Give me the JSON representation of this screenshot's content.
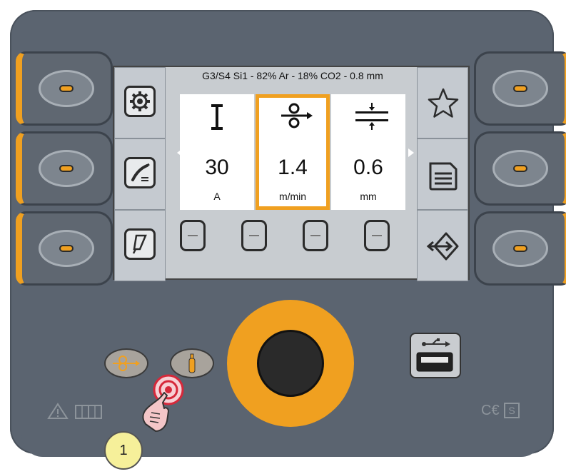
{
  "screen": {
    "title": "G3/S4 Si1 - 82% Ar - 18% CO2 - 0.8 mm",
    "params": [
      {
        "value": "30",
        "unit": "A",
        "icon": "current-icon"
      },
      {
        "value": "1.4",
        "unit": "m/min",
        "icon": "wire-feed-icon",
        "selected": true
      },
      {
        "value": "0.6",
        "unit": "mm",
        "icon": "thickness-icon"
      }
    ],
    "mini_buttons": [
      "—",
      "—",
      "—",
      "—"
    ],
    "left_softkeys": [
      "settings-gear-icon",
      "torch-icon",
      "arc-edit-icon"
    ],
    "right_softkeys": [
      "favorite-star-icon",
      "document-icon",
      "import-export-icon"
    ]
  },
  "controls": {
    "wire_inch_icon": "wire-inching-icon",
    "gas_test_icon": "gas-cylinder-icon",
    "usb_icon": "usb-port-icon",
    "footer_left_icons": [
      "warning-icon",
      "manual-icon"
    ],
    "footer_right_text": "C€",
    "footer_right_badge": "S",
    "callout_number": "1"
  },
  "colors": {
    "accent": "#f0a020",
    "panel": "#5b6470",
    "screen": "#c8ccd0"
  }
}
